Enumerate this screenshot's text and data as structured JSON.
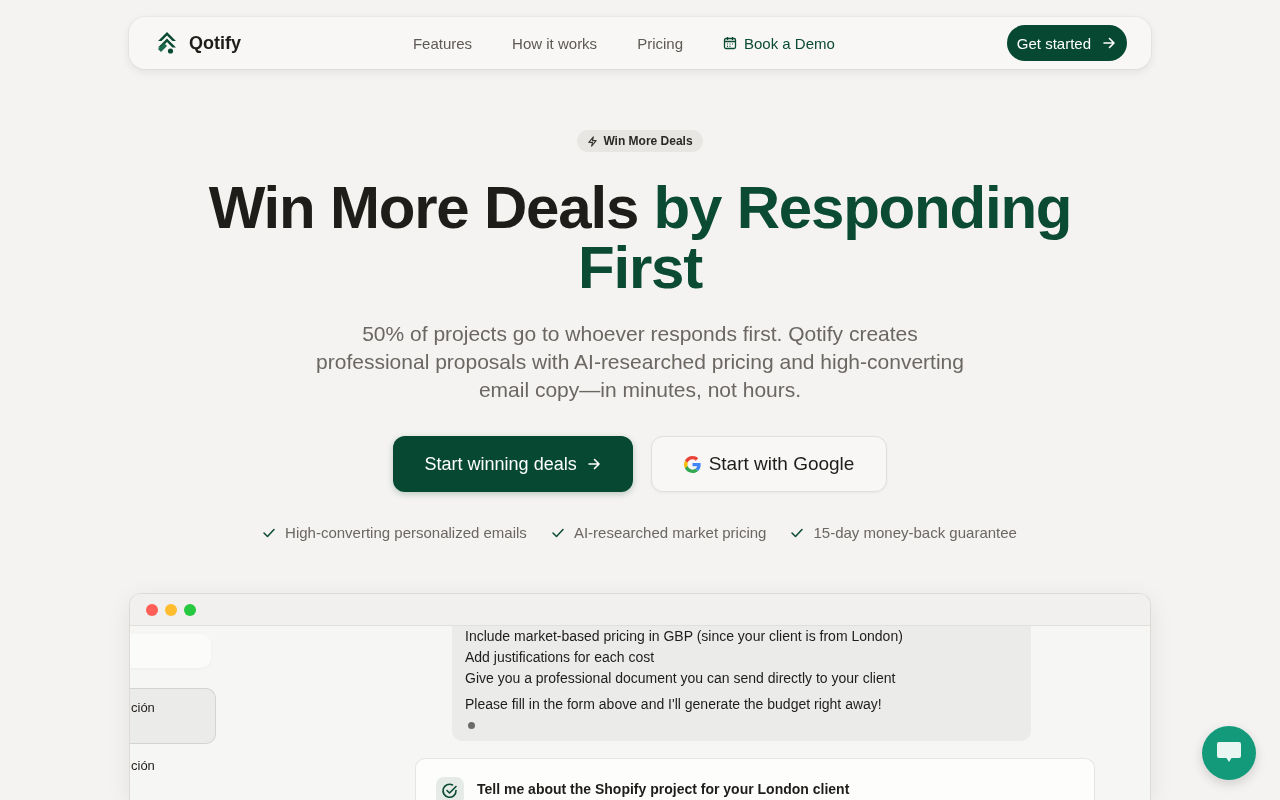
{
  "nav": {
    "brand": "Qotify",
    "links": [
      {
        "label": "Features",
        "kind": "plain"
      },
      {
        "label": "How it works",
        "kind": "plain"
      },
      {
        "label": "Pricing",
        "kind": "plain"
      },
      {
        "label": "Book a Demo",
        "kind": "demo"
      }
    ],
    "cta": "Get started"
  },
  "hero": {
    "badge": "Win More Deals",
    "headline": {
      "text": "Win More Deals",
      "highlight": "by Responding First"
    },
    "subtitle": "50% of projects go to whoever responds first. Qotify creates professional proposals with AI-researched pricing and high-converting email copy—in minutes, not hours.",
    "buttons": [
      {
        "label": "Start winning deals",
        "kind": "primary"
      },
      {
        "label": "Start with Google",
        "kind": "google"
      }
    ],
    "benefits": [
      "High-converting personalized emails",
      "AI-researched market pricing",
      "15-day money-back guarantee"
    ]
  },
  "preview": {
    "sidebar": {
      "items": [
        {
          "label": "ción",
          "selected": true
        },
        {
          "label": "ción",
          "selected": false
        }
      ]
    },
    "message": {
      "list_items": [
        "Include market-based pricing in GBP (since your client is from London)",
        "Add justifications for each cost",
        "Give you a professional document you can send directly to your client"
      ],
      "closing": "Please fill in the form above and I'll generate the budget right away!"
    },
    "task": {
      "title": "Tell me about the Shopify project for your London client"
    }
  }
}
